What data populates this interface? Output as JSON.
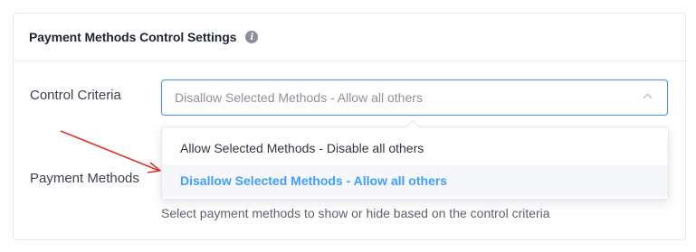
{
  "header": {
    "title": "Payment Methods Control Settings",
    "info_icon": "info-icon"
  },
  "control_criteria": {
    "label": "Control Criteria",
    "selected_value": "Disallow Selected Methods - Allow all others",
    "open": true
  },
  "dropdown": {
    "options": [
      "Allow Selected Methods - Disable all others",
      "Disallow Selected Methods - Allow all others"
    ],
    "selected_index": 1
  },
  "payment_methods": {
    "label": "Payment Methods",
    "helper_text": "Select payment methods to show or hide based on the control criteria"
  },
  "annotation": {
    "arrow_color": "#d9342b"
  },
  "colors": {
    "accent": "#409eff",
    "focus_border": "#4a90e2"
  }
}
